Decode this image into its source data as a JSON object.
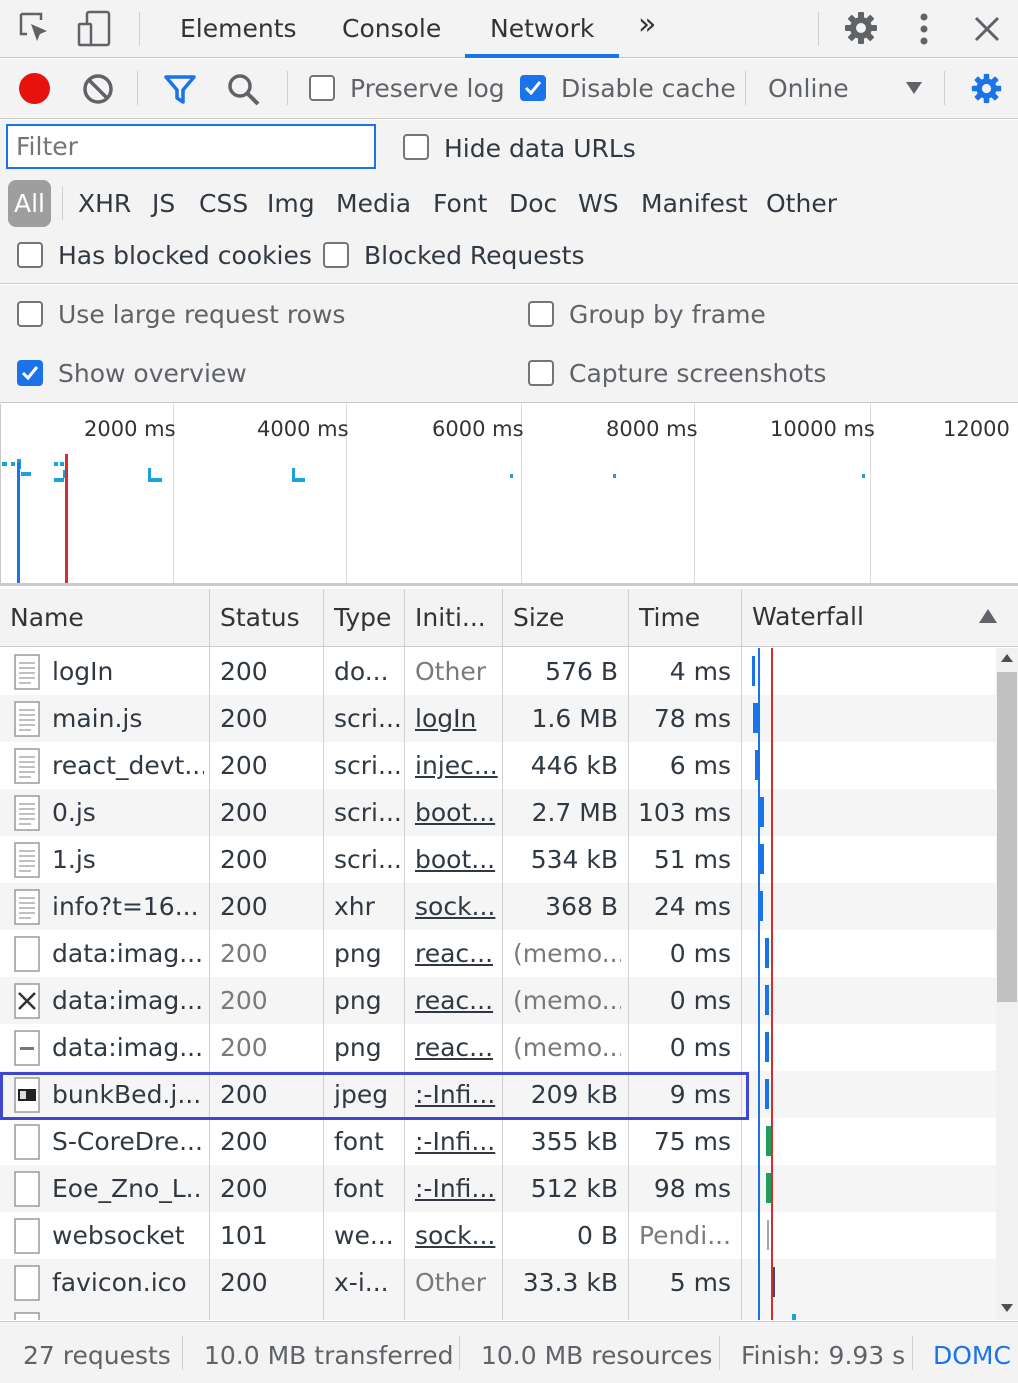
{
  "tabs": {
    "elements": "Elements",
    "console": "Console",
    "network": "Network",
    "more": "»"
  },
  "toolbar": {
    "preserve_log": "Preserve log",
    "disable_cache": "Disable cache",
    "throttle": "Online"
  },
  "filter": {
    "placeholder": "Filter",
    "hide_data_urls": "Hide data URLs"
  },
  "types": [
    "All",
    "XHR",
    "JS",
    "CSS",
    "Img",
    "Media",
    "Font",
    "Doc",
    "WS",
    "Manifest",
    "Other"
  ],
  "blocked": {
    "cookies": "Has blocked cookies",
    "requests": "Blocked Requests"
  },
  "settings": {
    "large_rows": "Use large request rows",
    "group_by_frame": "Group by frame",
    "show_overview": "Show overview",
    "capture_screenshots": "Capture screenshots"
  },
  "overview": {
    "ticks": [
      "2000 ms",
      "4000 ms",
      "6000 ms",
      "8000 ms",
      "10000 ms",
      "12000 ms"
    ]
  },
  "columns": {
    "name": "Name",
    "status": "Status",
    "type": "Type",
    "initiator": "Initi...",
    "size": "Size",
    "time": "Time",
    "waterfall": "Waterfall"
  },
  "rows": [
    {
      "name": "logIn",
      "status": "200",
      "type": "do...",
      "initiator": "Other",
      "size": "576 B",
      "time": "4 ms"
    },
    {
      "name": "main.js",
      "status": "200",
      "type": "scri...",
      "initiator": "logIn",
      "size": "1.6 MB",
      "time": "78 ms"
    },
    {
      "name": "react_devt...",
      "status": "200",
      "type": "scri...",
      "initiator": "injec...",
      "size": "446 kB",
      "time": "6 ms"
    },
    {
      "name": "0.js",
      "status": "200",
      "type": "scri...",
      "initiator": "boot...",
      "size": "2.7 MB",
      "time": "103 ms"
    },
    {
      "name": "1.js",
      "status": "200",
      "type": "scri...",
      "initiator": "boot...",
      "size": "534 kB",
      "time": "51 ms"
    },
    {
      "name": "info?t=16...",
      "status": "200",
      "type": "xhr",
      "initiator": "sock...",
      "size": "368 B",
      "time": "24 ms"
    },
    {
      "name": "data:imag...",
      "status": "200",
      "type": "png",
      "initiator": "reac...",
      "size": "(memo...",
      "time": "0 ms"
    },
    {
      "name": "data:imag...",
      "status": "200",
      "type": "png",
      "initiator": "reac...",
      "size": "(memo...",
      "time": "0 ms"
    },
    {
      "name": "data:imag...",
      "status": "200",
      "type": "png",
      "initiator": "reac...",
      "size": "(memo...",
      "time": "0 ms"
    },
    {
      "name": "bunkBed.j...",
      "status": "200",
      "type": "jpeg",
      "initiator": ":-Infi...",
      "size": "209 kB",
      "time": "9 ms"
    },
    {
      "name": "S-CoreDre...",
      "status": "200",
      "type": "font",
      "initiator": ":-Infi...",
      "size": "355 kB",
      "time": "75 ms"
    },
    {
      "name": "Eoe_Zno_L...",
      "status": "200",
      "type": "font",
      "initiator": ":-Infi...",
      "size": "512 kB",
      "time": "98 ms"
    },
    {
      "name": "websocket",
      "status": "101",
      "type": "we...",
      "initiator": "sock...",
      "size": "0 B",
      "time": "Pendi..."
    },
    {
      "name": "favicon.ico",
      "status": "200",
      "type": "x-i...",
      "initiator": "Other",
      "size": "33.3 kB",
      "time": "5 ms"
    }
  ],
  "status_bar": {
    "requests": "27 requests",
    "transferred": "10.0 MB transferred",
    "resources": "10.0 MB resources",
    "finish": "Finish: 9.93 s",
    "domc": "DOMC"
  },
  "colors": {
    "accent": "#1a73e8",
    "record": "#e8120c",
    "selected_outline": "#3f48cc",
    "load_line": "#d32f2f",
    "dom_line": "#1a73e8"
  }
}
